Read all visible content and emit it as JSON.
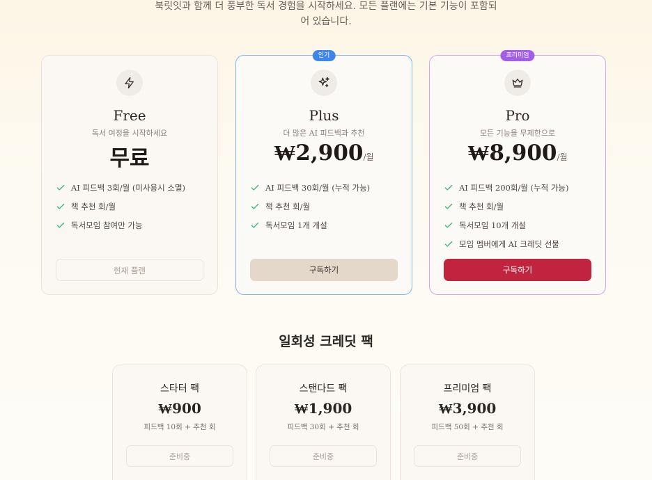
{
  "intro": {
    "line1": "북릿잇과 함께 더 풍부한 독서 경험을 시작하세요. 모든 플랜에는 기본 기능이 포함되",
    "line2": "어 있습니다."
  },
  "plans": [
    {
      "icon": "lightning-icon",
      "name": "Free",
      "subtitle": "독서 여정을 시작하세요",
      "price": "무료",
      "unit": "",
      "features": [
        "AI 피드백 3회/월 (미사용시 소멸)",
        "책 추천 회/월",
        "독서모임 참여만 가능"
      ],
      "button": "현재 플랜"
    },
    {
      "badge": "인기",
      "icon": "sparkle-icon",
      "name": "Plus",
      "subtitle": "더 많은 AI 피드백과 추천",
      "price": "₩2,900",
      "unit": "/월",
      "features": [
        "AI 피드백 30회/월 (누적 가능)",
        "책 추천 회/월",
        "독서모임 1개 개설"
      ],
      "button": "구독하기"
    },
    {
      "badge": "프리미엄",
      "icon": "crown-icon",
      "name": "Pro",
      "subtitle": "모든 기능을 무제한으로",
      "price": "₩8,900",
      "unit": "/월",
      "features": [
        "AI 피드백 200회/월 (누적 가능)",
        "책 추천 회/월",
        "독서모임 10개 개설",
        "모임 멤버에게 AI 크레딧 선물"
      ],
      "button": "구독하기"
    }
  ],
  "credit_section": {
    "title": "일회성 크레딧 팩",
    "packs": [
      {
        "name": "스타터 팩",
        "price": "₩900",
        "desc": "피드백 10회 + 추천 회",
        "button": "준비중"
      },
      {
        "name": "스탠다드 팩",
        "price": "₩1,900",
        "desc": "피드백 30회 + 추천 회",
        "button": "준비중"
      },
      {
        "name": "프리미엄 팩",
        "price": "₩3,900",
        "desc": "피드백 50회 + 추천 회",
        "button": "준비중"
      }
    ]
  },
  "colors": {
    "accent_blue": "#3f86ea",
    "accent_purple": "#a35ee8",
    "subscribe_red": "#c0243f",
    "check_green": "#3cb371"
  }
}
